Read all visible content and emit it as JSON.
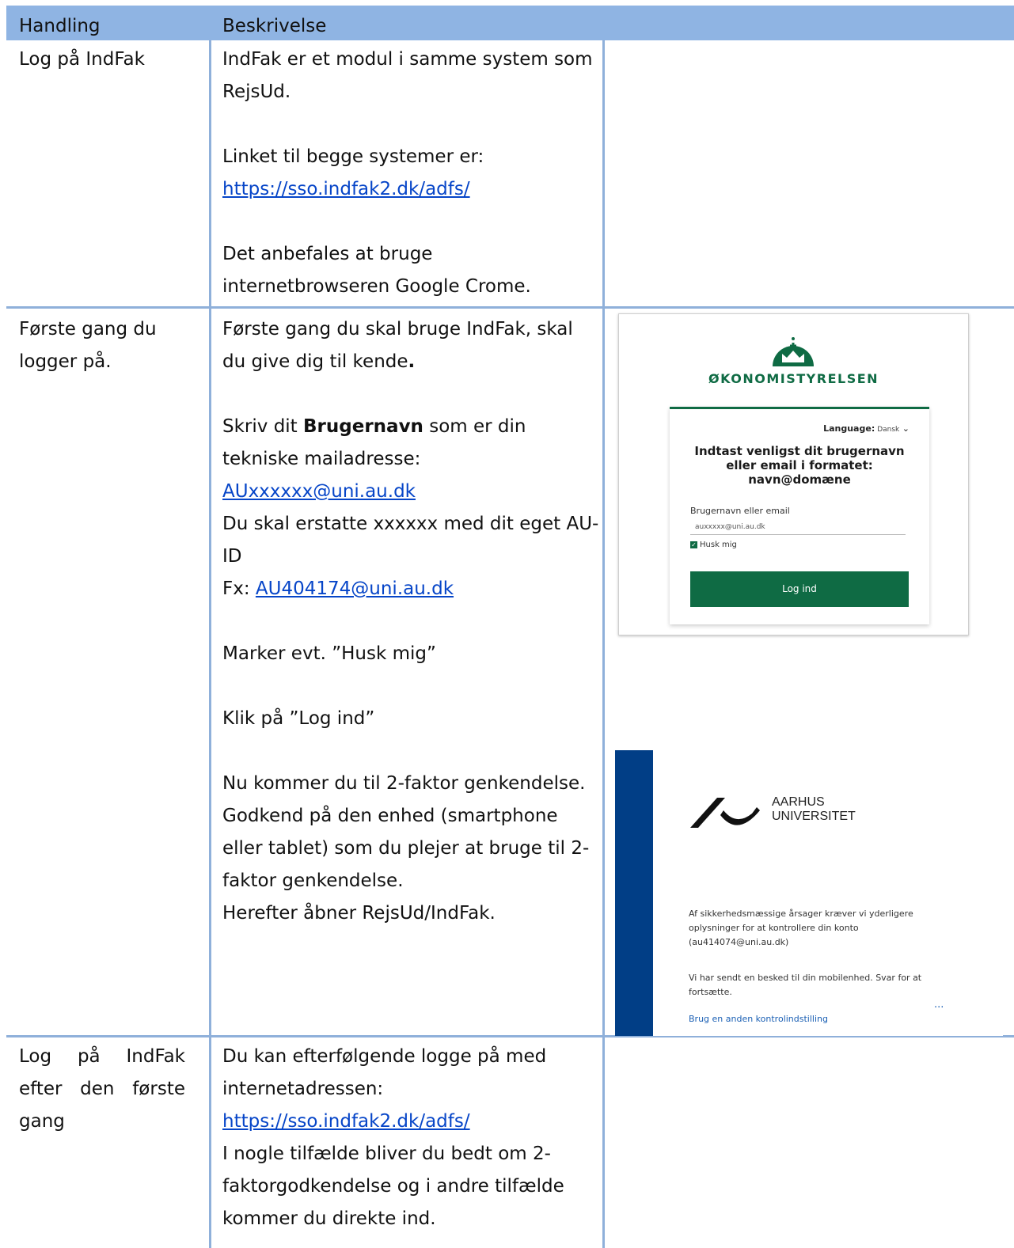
{
  "header": {
    "col1": "Handling",
    "col2": "Beskrivelse"
  },
  "rows": [
    {
      "action": "Log på IndFak",
      "desc": {
        "p1": "IndFak er et modul i samme system som RejsUd.",
        "p2": "Linket til begge systemer er:",
        "link": "https://sso.indfak2.dk/adfs/",
        "p3": "Det anbefales at bruge internetbrowseren Google Crome."
      }
    },
    {
      "action": "Første gang du logger på.",
      "desc": {
        "p1_a": "Første gang du skal bruge IndFak, skal du give dig til kende",
        "p1_b": ".",
        "p2_a": "Skriv dit ",
        "p2_bold": "Brugernavn",
        "p2_c": " som er din tekniske mailadresse: ",
        "p2_link": "AUxxxxxx@uni.au.dk",
        "p2_d": "Du skal erstatte xxxxxx med dit eget AU-ID",
        "p2_e": "Fx: ",
        "p2_link2": "AU404174@uni.au.dk",
        "p3": "Marker evt. ”Husk mig”",
        "p4": "Klik på ”Log ind”",
        "p5": "Nu kommer du til 2-faktor genkendelse. Godkend på den enhed (smartphone eller tablet) som du plejer at bruge til 2-faktor genkendelse.",
        "p6": "Herefter åbner RejsUd/IndFak."
      }
    },
    {
      "action": "Log på IndFak efter den første gang",
      "desc": {
        "p1": "Du kan efterfølgende logge på med internetadressen:",
        "link": "https://sso.indfak2.dk/adfs/",
        "p2": "I nogle tilfælde bliver du bedt om 2-faktorgodkendelse og i andre tilfælde kommer du direkte ind."
      }
    }
  ],
  "login_screenshot": {
    "org": "ØKONOMISTYRELSEN",
    "language_label": "Language:",
    "language_value": "Dansk",
    "prompt": "Indtast venligst dit brugernavn eller email i formatet: navn@domæne",
    "user_label": "Brugernavn eller email",
    "user_value": "auxxxxx@uni.au.dk",
    "remember": "Husk mig",
    "login_button": "Log ind",
    "accent": "#0f6b44"
  },
  "mfa_screenshot": {
    "uni_line1": "AARHUS",
    "uni_line2": "UNIVERSITET",
    "msg1": "Af sikkerhedsmæssige årsager kræver vi yderligere oplysninger for at kontrollere din konto (au414074@uni.au.dk)",
    "msg2": "Vi har sendt en besked til din mobilenhed. Svar for at fortsætte.",
    "dots": "...",
    "alt_link": "Brug en anden kontrolindstilling",
    "accent": "#013e86"
  }
}
